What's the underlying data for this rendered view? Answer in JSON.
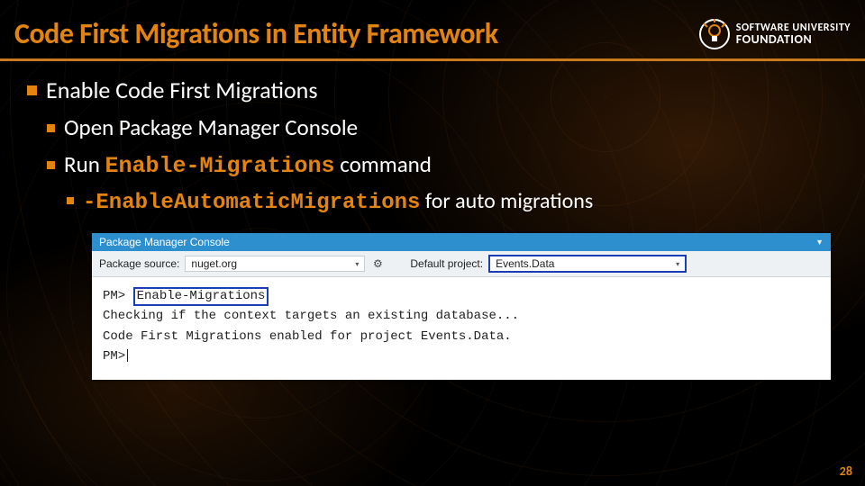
{
  "header": {
    "title": "Code First Migrations in Entity Framework",
    "logo": {
      "line1": "SOFTWARE UNIVERSITY",
      "line2": "FOUNDATION"
    }
  },
  "content": {
    "level1": "Enable Code First Migrations",
    "level2a": "Open Package Manager Console",
    "level2b_pre": "Run ",
    "level2b_code": "Enable-Migrations",
    "level2b_post": " command",
    "level3_code": "-EnableAutomaticMigrations",
    "level3_post": " for auto migrations"
  },
  "console": {
    "title": "Package Manager Console",
    "toolbar": {
      "source_label": "Package source:",
      "source_value": "nuget.org",
      "default_project_label": "Default project:",
      "default_project_value": "Events.Data"
    },
    "lines": {
      "prompt": "PM>",
      "command": "Enable-Migrations",
      "out1": "Checking if the context targets an existing database...",
      "out2": "Code First Migrations enabled for project Events.Data."
    }
  },
  "page_number": "28"
}
